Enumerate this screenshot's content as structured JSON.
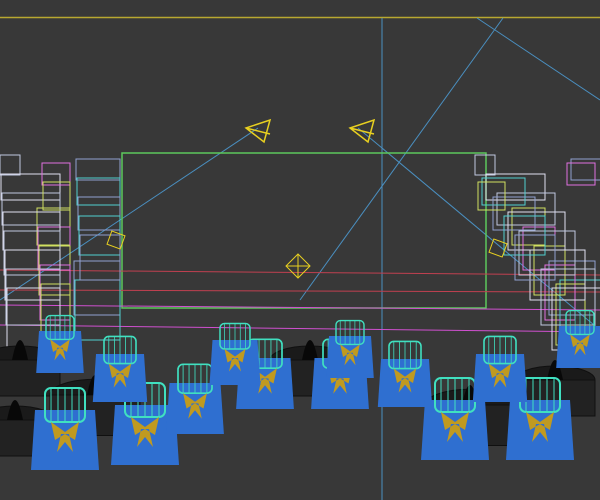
{
  "viewport": {
    "background": "#383838",
    "frame_color": "#b8a830",
    "guide_color": "#4a8fc0",
    "camera_color": "#e8d020",
    "stage_color": "#5cc85c",
    "chair_cover": "#2f6fd0",
    "chair_back": "#40e0c0",
    "bow_color": "#c09a20",
    "table_wire": "#101010"
  }
}
